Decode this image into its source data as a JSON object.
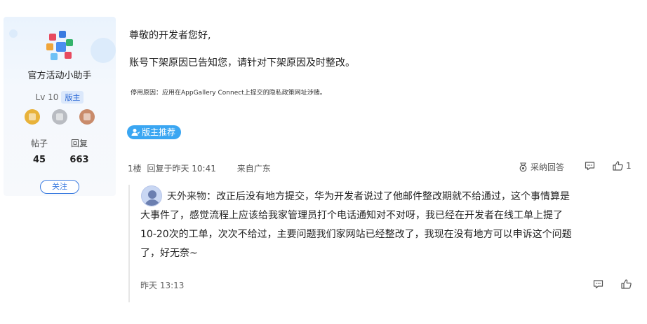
{
  "profile": {
    "username": "官方活动小助手",
    "level": "Lv 10",
    "role_badge": "版主",
    "medals": [
      {
        "icon": "gold-medal-icon",
        "color": "#e8b23a"
      },
      {
        "icon": "silver-medal-icon",
        "color": "#b9bcc2"
      },
      {
        "icon": "bronze-medal-icon",
        "color": "#c98b6b"
      }
    ],
    "stats": [
      {
        "label": "帖子",
        "value": "45"
      },
      {
        "label": "回复",
        "value": "663"
      }
    ],
    "follow_label": "关注"
  },
  "post": {
    "greeting": "尊敬的开发者您好,",
    "message": "账号下架原因已告知您，请针对下架原因及时整改。",
    "reason": "停用原因：应用在AppGallery Connect上提交的隐私政策网址涉赌。",
    "recommend_label": "版主推荐",
    "floor": "1楼",
    "reply_time": "回复于昨天 10:41",
    "location": "来自广东",
    "accept_label": "采纳回答",
    "like_count": "1"
  },
  "reply": {
    "user": "天外来物",
    "separator": "：",
    "lines": [
      "改正后没有地方提交，华为开发者说过了他邮件整改期就不给通过，这个事情算是",
      "大事件了，感觉流程上应该给我家管理员打个电话通知对不对呀，我已经在开发者在线工单上提了",
      "10-20次的工单，次次不给过，主要问题我们家网站已经整改了，我现在没有地方可以申诉这个问题",
      "了，好无奈~"
    ],
    "time": "昨天 13:13"
  },
  "colors": {
    "accent": "#3a7be0",
    "recommend_bg": "#3aa6f2"
  }
}
